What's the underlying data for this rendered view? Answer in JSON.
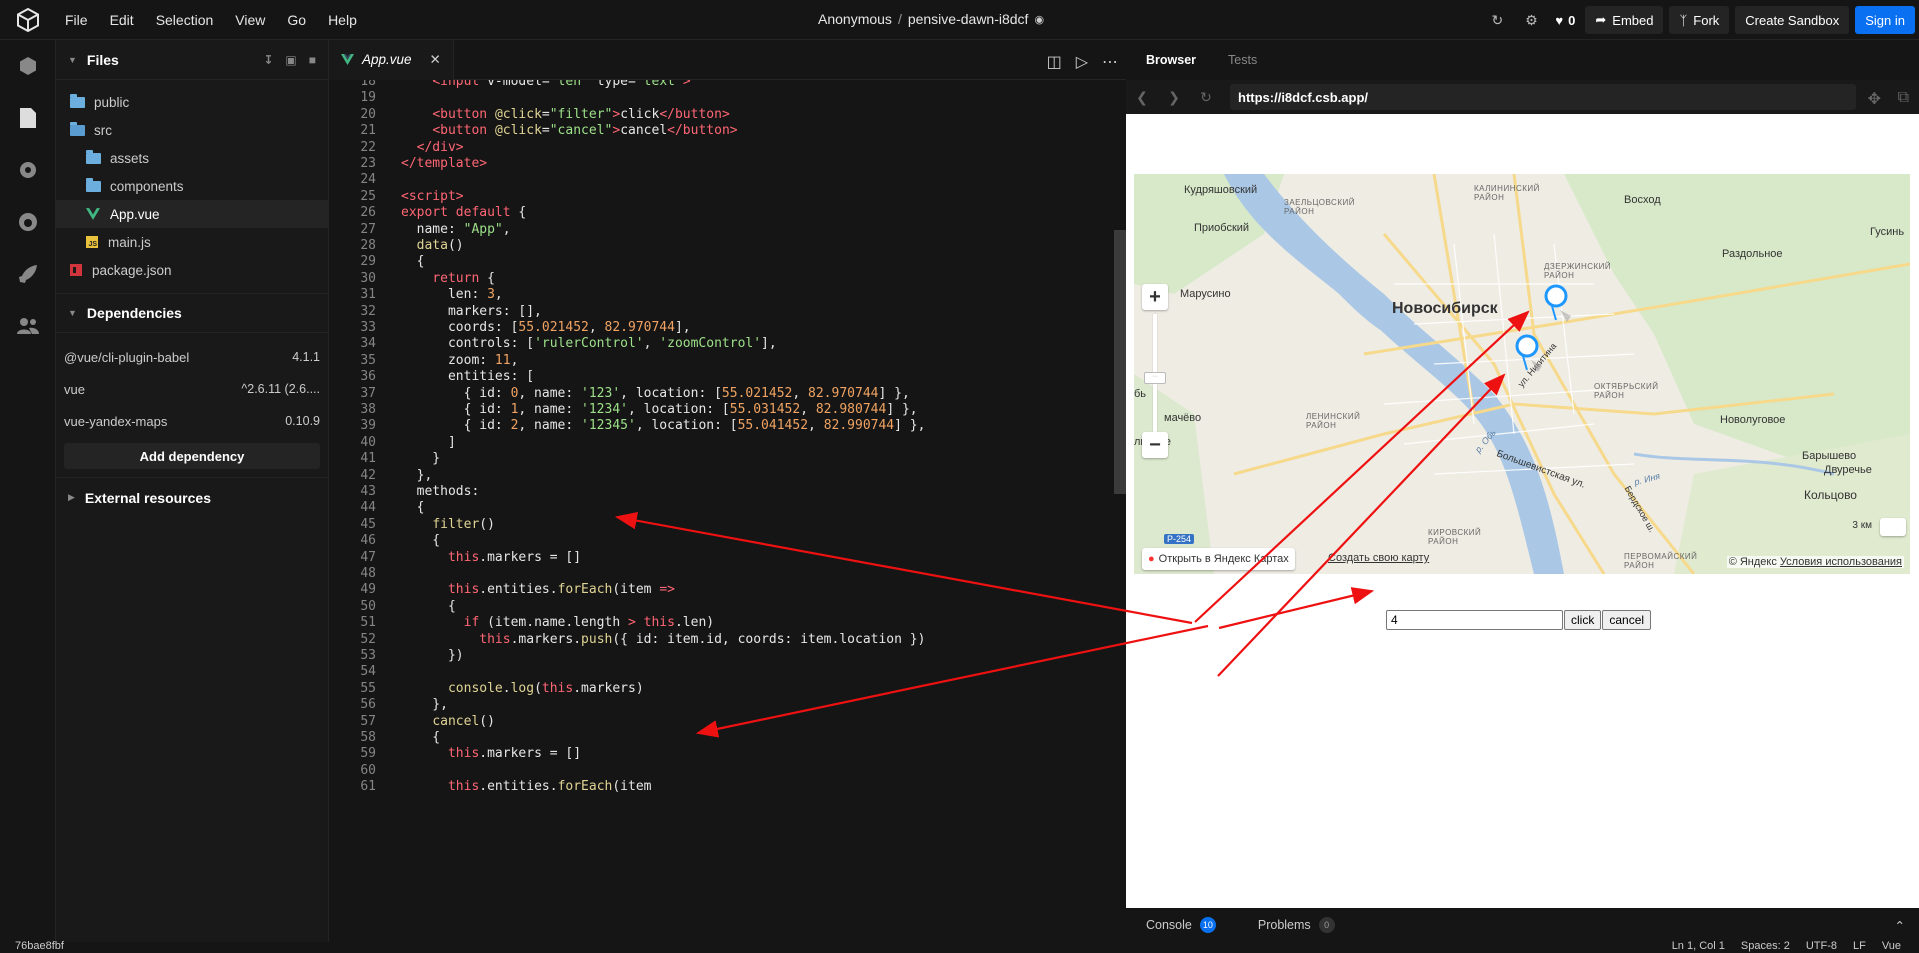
{
  "menu": [
    "File",
    "Edit",
    "Selection",
    "View",
    "Go",
    "Help"
  ],
  "header": {
    "owner": "Anonymous",
    "separator": "/",
    "sandbox": "pensive-dawn-i8dcf",
    "likes": "0",
    "embed": "Embed",
    "fork": "Fork",
    "create": "Create Sandbox",
    "signin": "Sign in"
  },
  "sidebar": {
    "files_title": "Files",
    "tree": [
      {
        "name": "public",
        "type": "folder",
        "indent": 0
      },
      {
        "name": "src",
        "type": "folder-open",
        "indent": 0
      },
      {
        "name": "assets",
        "type": "folder",
        "indent": 1
      },
      {
        "name": "components",
        "type": "folder",
        "indent": 1
      },
      {
        "name": "App.vue",
        "type": "vue",
        "indent": 1,
        "active": true
      },
      {
        "name": "main.js",
        "type": "js",
        "indent": 1
      },
      {
        "name": "package.json",
        "type": "npm",
        "indent": 0
      }
    ],
    "deps_title": "Dependencies",
    "deps": [
      {
        "name": "@vue/cli-plugin-babel",
        "version": "4.1.1"
      },
      {
        "name": "vue",
        "version": "^2.6.11 (2.6...."
      },
      {
        "name": "vue-yandex-maps",
        "version": "0.10.9"
      }
    ],
    "add_dep": "Add dependency",
    "external_title": "External resources"
  },
  "editor": {
    "tab": "App.vue",
    "lines": [
      {
        "n": "18",
        "html": "    <span class='tg'>&lt;input</span> <span class='pr'>v-model=</span><span class='st'>\"len\"</span> <span class='pr'>type=</span><span class='st'>\"text\"</span><span class='tg'>&gt;</span>"
      },
      {
        "n": "19",
        "html": ""
      },
      {
        "n": "20",
        "html": "    <span class='tg'>&lt;button</span> <span class='fn'>@click</span>=<span class='st'>\"filter\"</span><span class='tg'>&gt;</span>click<span class='tg'>&lt;/button&gt;</span>"
      },
      {
        "n": "21",
        "html": "    <span class='tg'>&lt;button</span> <span class='fn'>@click</span>=<span class='st'>\"cancel\"</span><span class='tg'>&gt;</span>cancel<span class='tg'>&lt;/button&gt;</span>"
      },
      {
        "n": "22",
        "html": "  <span class='tg'>&lt;/div&gt;</span>"
      },
      {
        "n": "23",
        "html": "<span class='tg'>&lt;/template&gt;</span>"
      },
      {
        "n": "24",
        "html": ""
      },
      {
        "n": "25",
        "html": "<span class='tg'>&lt;script&gt;</span>"
      },
      {
        "n": "26",
        "html": "<span class='kw'>export default</span> {"
      },
      {
        "n": "27",
        "html": "  name: <span class='st'>\"App\"</span>,"
      },
      {
        "n": "28",
        "html": "  <span class='fn'>data</span>()"
      },
      {
        "n": "29",
        "html": "  {"
      },
      {
        "n": "30",
        "html": "    <span class='kw'>return</span> {"
      },
      {
        "n": "31",
        "html": "      len: <span class='nm'>3</span>,"
      },
      {
        "n": "32",
        "html": "      markers: [],"
      },
      {
        "n": "33",
        "html": "      coords: [<span class='nm'>55.021452</span>, <span class='nm'>82.970744</span>],"
      },
      {
        "n": "34",
        "html": "      controls: [<span class='st'>'rulerControl'</span>, <span class='st'>'zoomControl'</span>],"
      },
      {
        "n": "35",
        "html": "      zoom: <span class='nm'>11</span>,"
      },
      {
        "n": "36",
        "html": "      entities: ["
      },
      {
        "n": "37",
        "html": "        { id: <span class='nm'>0</span>, name: <span class='st'>'123'</span>, location: [<span class='nm'>55.021452</span>, <span class='nm'>82.970744</span>] },"
      },
      {
        "n": "38",
        "html": "        { id: <span class='nm'>1</span>, name: <span class='st'>'1234'</span>, location: [<span class='nm'>55.031452</span>, <span class='nm'>82.980744</span>] },"
      },
      {
        "n": "39",
        "html": "        { id: <span class='nm'>2</span>, name: <span class='st'>'12345'</span>, location: [<span class='nm'>55.041452</span>, <span class='nm'>82.990744</span>] },"
      },
      {
        "n": "40",
        "html": "      ]"
      },
      {
        "n": "41",
        "html": "    }"
      },
      {
        "n": "42",
        "html": "  },"
      },
      {
        "n": "43",
        "html": "  methods:"
      },
      {
        "n": "44",
        "html": "  {"
      },
      {
        "n": "45",
        "html": "    <span class='fn'>filter</span>()"
      },
      {
        "n": "46",
        "html": "    {"
      },
      {
        "n": "47",
        "html": "      <span class='kw'>this</span>.markers = []"
      },
      {
        "n": "48",
        "html": ""
      },
      {
        "n": "49",
        "html": "      <span class='kw'>this</span>.entities.<span class='fn'>forEach</span>(item <span class='kw'>=&gt;</span>"
      },
      {
        "n": "50",
        "html": "      {"
      },
      {
        "n": "51",
        "html": "        <span class='kw'>if</span> (item.name.length <span class='kw'>&gt;</span> <span class='kw'>this</span>.len)"
      },
      {
        "n": "52",
        "html": "          <span class='kw'>this</span>.markers.<span class='fn'>push</span>({ id: item.id, coords: item.location })"
      },
      {
        "n": "53",
        "html": "      })"
      },
      {
        "n": "54",
        "html": ""
      },
      {
        "n": "55",
        "html": "      <span class='fn'>console</span>.<span class='fn'>log</span>(<span class='kw'>this</span>.markers)"
      },
      {
        "n": "56",
        "html": "    },"
      },
      {
        "n": "57",
        "html": "    <span class='fn'>cancel</span>()"
      },
      {
        "n": "58",
        "html": "    {"
      },
      {
        "n": "59",
        "html": "      <span class='kw'>this</span>.markers = []"
      },
      {
        "n": "60",
        "html": ""
      },
      {
        "n": "61",
        "html": "      <span class='kw'>this</span>.entities.<span class='fn'>forEach</span>(item"
      }
    ]
  },
  "preview": {
    "tab_browser": "Browser",
    "tab_tests": "Tests",
    "url": "https://i8dcf.csb.app/",
    "input_value": "4",
    "btn_click": "click",
    "btn_cancel": "cancel",
    "map": {
      "city": "Новосибирск",
      "places": [
        "Кудряшовский",
        "Приобский",
        "Марусино",
        "Восход",
        "Раздольное",
        "Гусинь",
        "Новолуговое",
        "Барышево",
        "Двуречье",
        "Кольцово",
        "мачёво",
        "линное",
        "бь"
      ],
      "districts": [
        "ЗАЕЛЬЦОВСКИЙ РАЙОН",
        "КАЛИНИНСКИЙ РАЙОН",
        "ДЗЕРЖИНСКИЙ РАЙОН",
        "ОКТЯБРЬСКИЙ РАЙОН",
        "ЛЕНИНСКИЙ РАЙОН",
        "КИРОВСКИЙ РАЙОН",
        "ПЕРВОМАЙСКИЙ РАЙОН"
      ],
      "streets": [
        "ул. Никитина",
        "Большевистская ул.",
        "р. Обь",
        "р. Иня",
        "Бердское ш."
      ],
      "open_in": "Открыть в Яндекс Картах",
      "create_map": "Создать свою карту",
      "copyright": "© Яндекс",
      "terms": "Условия использования",
      "scale": "3 км",
      "road": "Р-254"
    },
    "console": "Console",
    "console_count": "10",
    "problems": "Problems",
    "problems_count": "0"
  },
  "status": {
    "hash": "76bae8fbf",
    "position": "Ln 1, Col 1",
    "spaces": "Spaces: 2",
    "encoding": "UTF-8",
    "eol": "LF",
    "lang": "Vue"
  },
  "colors": {
    "accent": "#0971f1",
    "arrow": "#ee1111",
    "marker": "#1e98ff"
  }
}
